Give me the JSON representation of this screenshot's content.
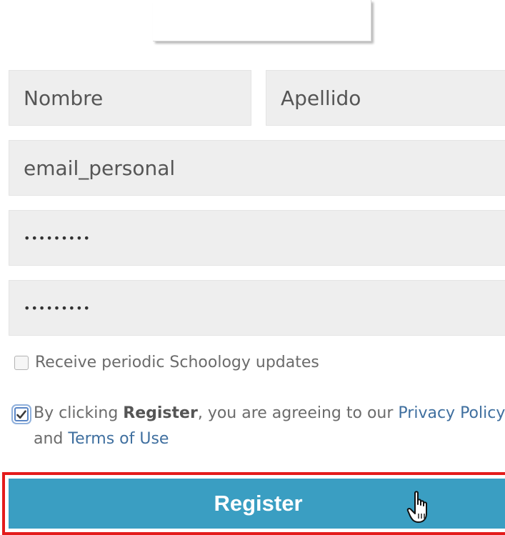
{
  "form": {
    "first_name_placeholder": "Nombre",
    "last_name_placeholder": "Apellido",
    "email_value": "email_personal",
    "password_value": "•••••••••",
    "confirm_password_value": "•••••••••",
    "updates_label": "Receive periodic Schoology updates",
    "updates_checked": false,
    "terms": {
      "checked": true,
      "prefix": "By clicking ",
      "register_word": "Register",
      "middle": ", you are agreeing to our ",
      "privacy_link": "Privacy Policy",
      "and_text": " and ",
      "terms_link": "Terms of Use"
    },
    "register_label": "Register"
  },
  "colors": {
    "field_bg": "#eeeeee",
    "button_bg": "#3a9ec2",
    "link": "#3f6f9f",
    "highlight": "#e41b1b"
  },
  "icons": {
    "checkmark": "check-icon",
    "cursor": "hand-pointer-icon"
  }
}
